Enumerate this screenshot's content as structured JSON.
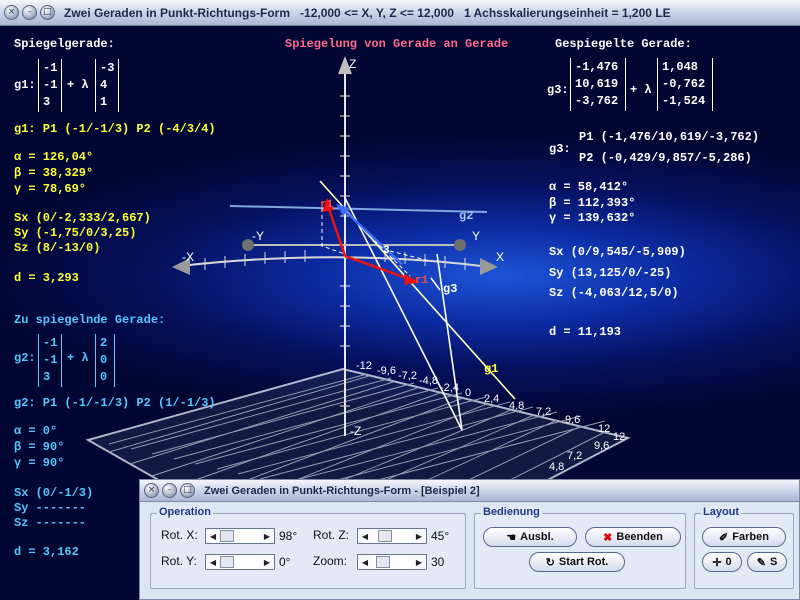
{
  "window": {
    "title": "Zwei Geraden in Punkt-Richtungs-Form",
    "range": "-12,000 <= X, Y, Z <= 12,000",
    "scale": "1 Achsskalierungseinheit = 1,200 LE"
  },
  "left": {
    "heading": "Spiegelgerade:",
    "g1_label": "g1:",
    "g1_p": [
      "-1",
      "-1",
      "3"
    ],
    "g1_lambda": "+ λ",
    "g1_d": [
      "-3",
      "4",
      "1"
    ],
    "g1_points": "g1: P1 (-1/-1/3)   P2 (-4/3/4)",
    "alpha": "α = 126,04°",
    "beta": "β = 38,329°",
    "gamma": "γ = 78,69°",
    "sx": "Sx (0/-2,333/2,667)",
    "sy": "Sy (-1,75/0/3,25)",
    "sz": "Sz (8/-13/0)",
    "d": "d = 3,293",
    "heading2": "Zu spiegelnde Gerade:",
    "g2_label": "g2:",
    "g2_p": [
      "-1",
      "-1",
      "3"
    ],
    "g2_lambda": "+ λ",
    "g2_d": [
      "2",
      "0",
      "0"
    ],
    "g2_points": "g2: P1 (-1/-1/3)   P2 (1/-1/3)",
    "alpha2": "α = 0°",
    "beta2": "β = 90°",
    "gamma2": "γ = 90°",
    "sx2": "Sx (0/-1/3)",
    "sy2": "Sy -------",
    "sz2": "Sz -------",
    "d2": "d = 3,162"
  },
  "center": {
    "heading": "Spiegelung von Gerade an Gerade"
  },
  "right": {
    "heading": "Gespiegelte Gerade:",
    "g3_label": "g3:",
    "g3_p": [
      "-1,476",
      "10,619",
      "-3,762"
    ],
    "g3_lambda": "+ λ",
    "g3_d": [
      "1,048",
      "-0,762",
      "-1,524"
    ],
    "g3_label2": "g3:",
    "p1": "P1 (-1,476/10,619/-3,762)",
    "p2": "P2 (-0,429/9,857/-5,286)",
    "alpha": "α = 58,412°",
    "beta": "β = 112,393°",
    "gamma": "γ = 139,632°",
    "sx": "Sx (0/9,545/-5,909)",
    "sy": "Sy (13,125/0/-25)",
    "sz": "Sz (-4,063/12,5/0)",
    "d": "d = 11,193"
  },
  "scene": {
    "axis_z": "Z",
    "axis_zneg": "-Z",
    "axis_x": "X",
    "axis_xneg": "-X",
    "axis_y": "Y",
    "axis_yneg": "-Y",
    "label_g1": "g1",
    "label_g2": "g2",
    "label_g3": "g3",
    "label_r1": "r1",
    "label_r2": "r1",
    "label_3": "3",
    "grid_back": [
      "-12",
      "-9,6",
      "-7,2",
      "-4,8",
      "-2,4",
      "0"
    ],
    "grid_front": [
      "2,4",
      "4,8",
      "7,2",
      "9,6",
      "12"
    ],
    "grid_side": [
      "12",
      "9,6",
      "7,2",
      "4,8"
    ],
    "grid_right": "12"
  },
  "panel": {
    "title": "Zwei Geraden in Punkt-Richtungs-Form - [Beispiel 2]",
    "operation_label": "Operation",
    "rotx_label": "Rot. X:",
    "rotx_value": "98°",
    "roty_label": "Rot. Y:",
    "roty_value": "0°",
    "rotz_label": "Rot. Z:",
    "rotz_value": "45°",
    "zoom_label": "Zoom:",
    "zoom_value": "30",
    "bedienung_label": "Bedienung",
    "ausbl_label": "Ausbl.",
    "beenden_label": "Beenden",
    "start_label": "Start Rot.",
    "layout_label": "Layout",
    "farben_label": "Farben",
    "zero_label": "0",
    "s_label": "S"
  }
}
